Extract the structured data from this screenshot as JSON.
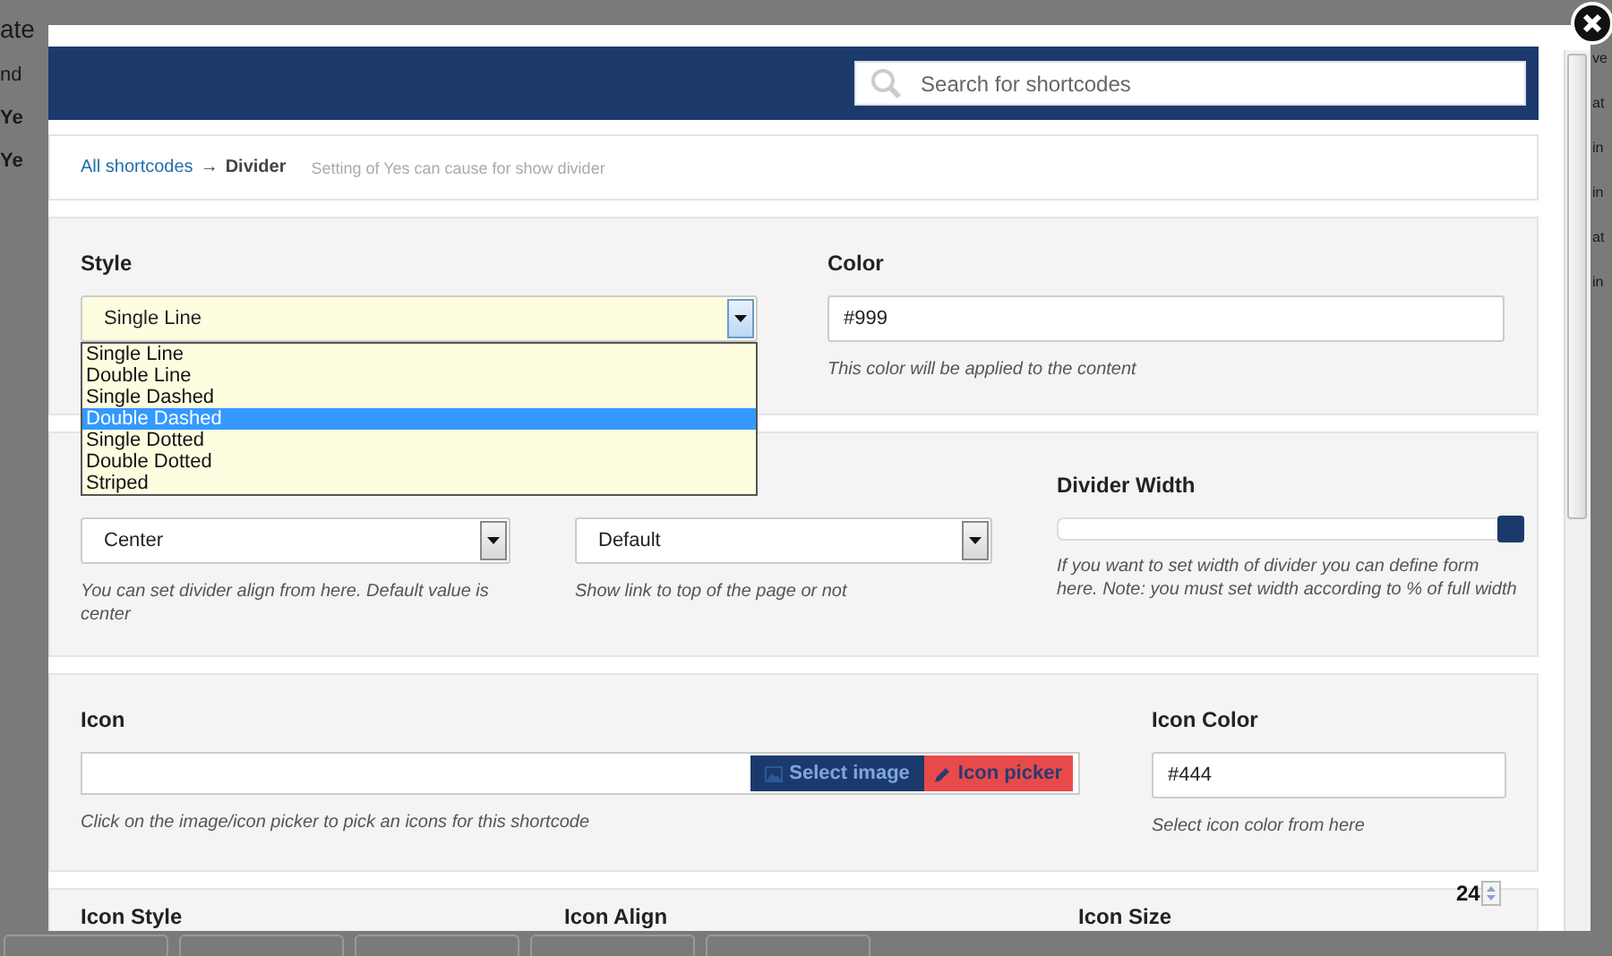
{
  "background": {
    "left_fragments": [
      "ate",
      "nd",
      "Ye",
      "Ye"
    ],
    "right_fragments": [
      "ve",
      "at",
      "in",
      "in",
      "at",
      "in"
    ]
  },
  "dialog": {
    "search": {
      "placeholder": "Search for shortcodes"
    },
    "breadcrumb": {
      "link": "All shortcodes",
      "separator": "→",
      "current": "Divider",
      "description": "Setting of Yes can cause for show divider"
    },
    "sections": [
      {
        "fields": [
          {
            "kind": "select",
            "label": "Style",
            "value": "Single Line",
            "open": true,
            "options": [
              {
                "label": "Single Line",
                "highlighted": false
              },
              {
                "label": "Double Line",
                "highlighted": false
              },
              {
                "label": "Single Dashed",
                "highlighted": false
              },
              {
                "label": "Double Dashed",
                "highlighted": true
              },
              {
                "label": "Single Dotted",
                "highlighted": false
              },
              {
                "label": "Double Dotted",
                "highlighted": false
              },
              {
                "label": "Striped",
                "highlighted": false
              }
            ]
          },
          {
            "kind": "text",
            "label": "Color",
            "value": "#999",
            "hint": "This color will be applied to the content"
          }
        ]
      },
      {
        "fields": [
          {
            "kind": "select",
            "value": "Center",
            "open": false,
            "hint": "You can set divider align from here. Default value is center"
          },
          {
            "kind": "select",
            "value": "Default",
            "open": false,
            "hint": "Show link to top of the page or not"
          },
          {
            "kind": "slider",
            "label": "Divider Width",
            "level": 1,
            "hint": "If you want to set width of divider you can define form here. Note: you must set width according to % of full width"
          }
        ]
      },
      {
        "fields": [
          {
            "kind": "icon_picker",
            "label": "Icon",
            "buttons": [
              "Select image",
              "Icon picker"
            ],
            "hint": "Click on the image/icon picker to pick an icons for this shortcode"
          },
          {
            "kind": "text",
            "label": "Icon Color",
            "value": "#444",
            "hint": "Select icon color from here"
          }
        ]
      },
      {
        "fields": [
          {
            "kind": "label",
            "label": "Icon Style"
          },
          {
            "kind": "label",
            "label": "Icon Align"
          },
          {
            "kind": "label",
            "label": "Icon Size"
          }
        ]
      }
    ],
    "spinner": {
      "value": "24"
    }
  }
}
